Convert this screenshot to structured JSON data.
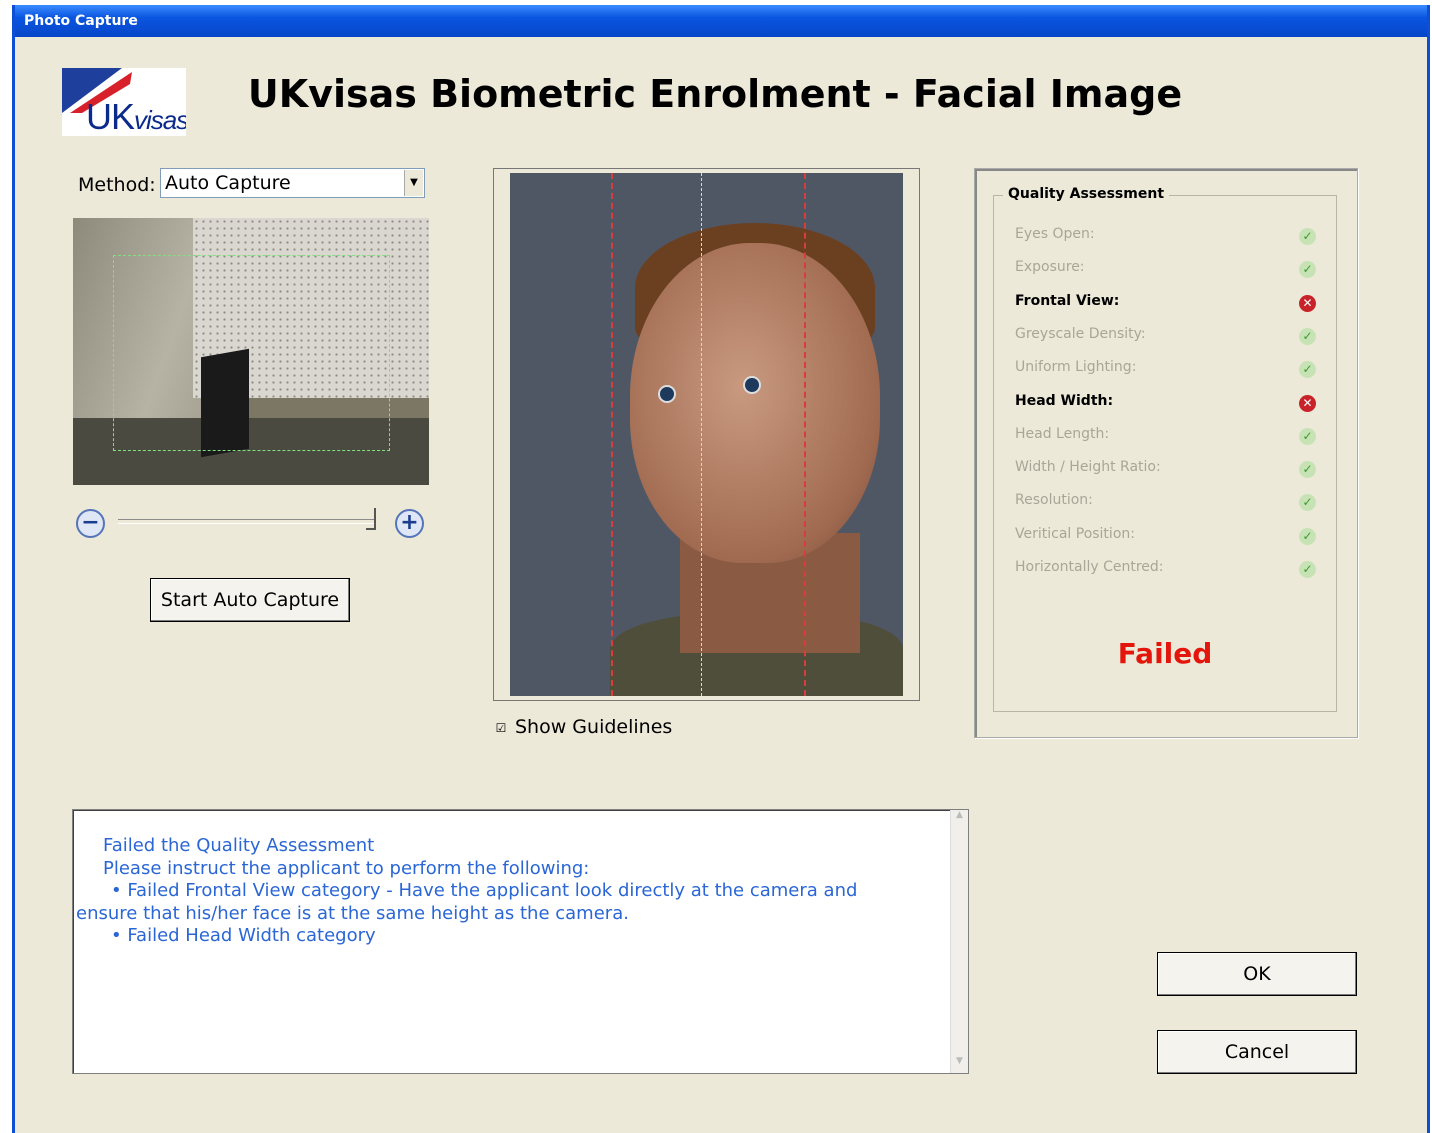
{
  "window": {
    "title": "Photo Capture",
    "accent": "#0a4fd6"
  },
  "logo": {
    "brand_uk": "UK",
    "brand_visas": "visas"
  },
  "header": {
    "title": "UKvisas Biometric Enrolment - Facial Image"
  },
  "capture": {
    "method_label": "Method:",
    "method_value": "Auto Capture",
    "start_button": "Start Auto Capture"
  },
  "photo": {
    "show_guidelines_label": "Show Guidelines",
    "show_guidelines_checked": true
  },
  "quality": {
    "title": "Quality Assessment",
    "items": [
      {
        "label": "Eyes Open:",
        "status": "pass"
      },
      {
        "label": "Exposure:",
        "status": "pass"
      },
      {
        "label": "Frontal View:",
        "status": "fail"
      },
      {
        "label": "Greyscale Density:",
        "status": "pass"
      },
      {
        "label": "Uniform Lighting:",
        "status": "pass"
      },
      {
        "label": "Head Width:",
        "status": "fail"
      },
      {
        "label": "Head Length:",
        "status": "pass"
      },
      {
        "label": "Width / Height Ratio:",
        "status": "pass"
      },
      {
        "label": "Resolution:",
        "status": "pass"
      },
      {
        "label": "Veritical Position:",
        "status": "pass"
      },
      {
        "label": "Horizontally Centred:",
        "status": "pass"
      }
    ],
    "result": "Failed",
    "result_color": "#e4160c"
  },
  "message": {
    "lines": [
      "Failed the Quality Assessment",
      "Please instruct the applicant to perform the following:",
      "•  Failed Frontal View category - Have the applicant look directly at the camera and",
      "ensure that his/her face is at the same height as the camera.",
      "•  Failed Head Width category"
    ]
  },
  "buttons": {
    "ok": "OK",
    "cancel": "Cancel"
  }
}
